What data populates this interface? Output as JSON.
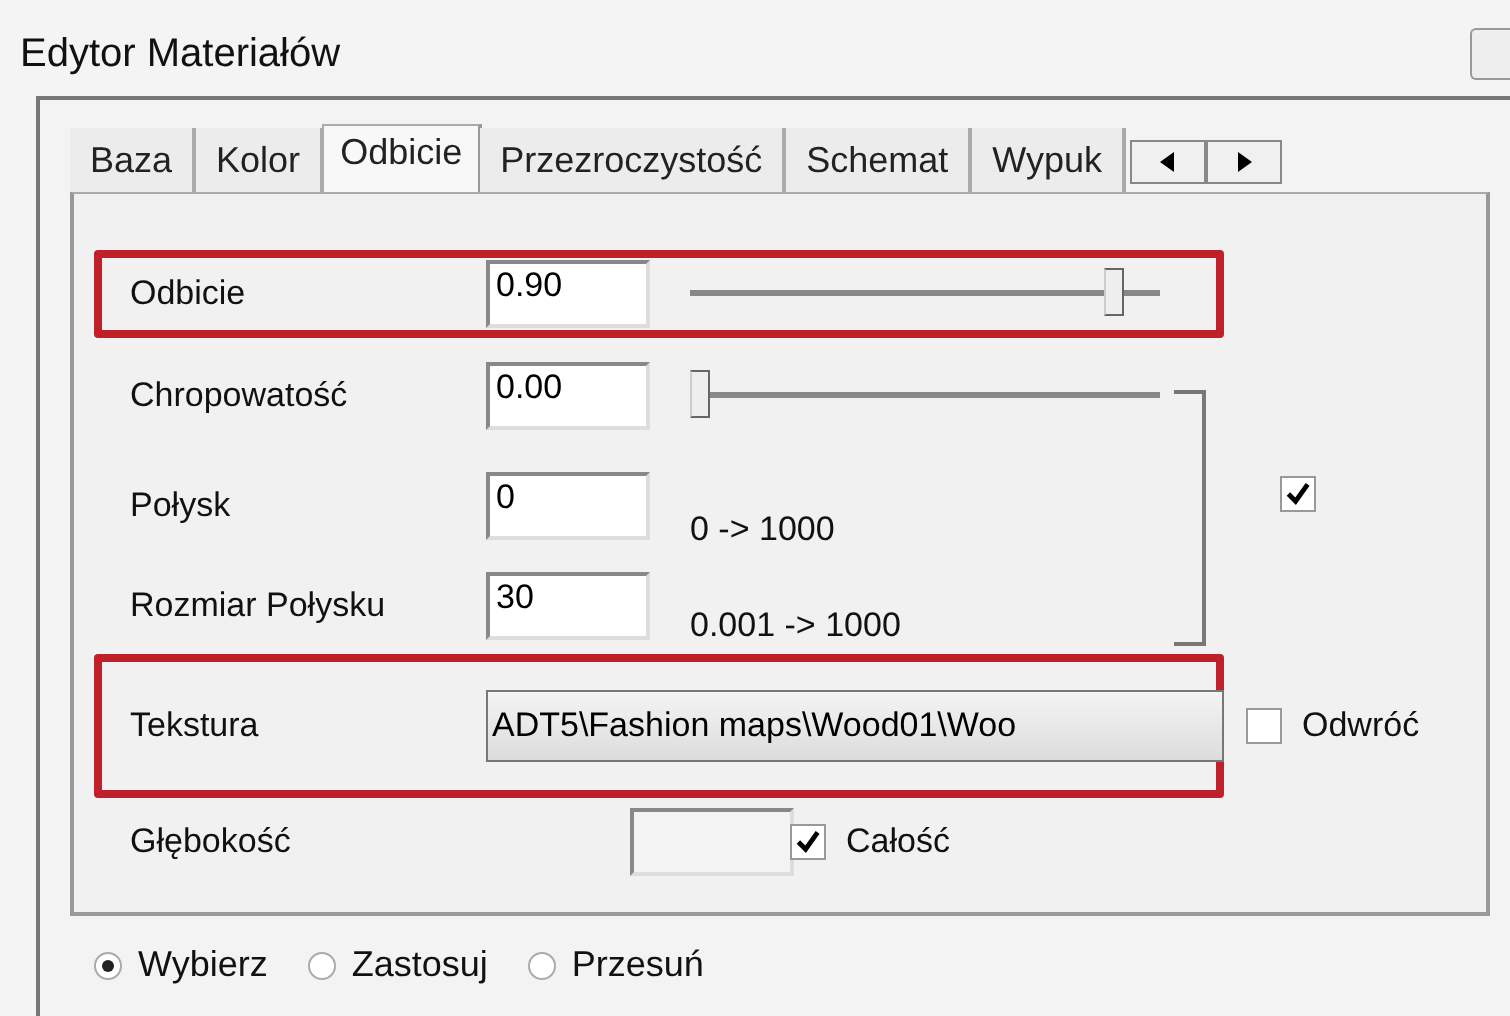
{
  "window": {
    "title": "Edytor Materiałów"
  },
  "tabs": [
    {
      "label": "Baza",
      "selected": false
    },
    {
      "label": "Kolor",
      "selected": false
    },
    {
      "label": "Odbicie",
      "selected": true
    },
    {
      "label": "Przezroczystość",
      "selected": false
    },
    {
      "label": "Schemat",
      "selected": false
    },
    {
      "label": "Wypuk",
      "selected": false
    }
  ],
  "rows": [
    {
      "kind": "slider",
      "label": "Odbicie",
      "value": "0.90",
      "level": 0.92,
      "highlighted": true
    },
    {
      "kind": "slider",
      "label": "Chropowatość",
      "value": "0.00",
      "level": 0,
      "highlighted": false
    },
    {
      "kind": "range",
      "label": "Połysk",
      "value": "0",
      "range": "0 -> 1000",
      "highlighted": false
    },
    {
      "kind": "range",
      "label": "Rozmiar Połysku",
      "value": "30",
      "range": "0.001 -> 1000",
      "highlighted": false
    },
    {
      "kind": "texture",
      "label": "Tekstura",
      "path": "ADT5\\Fashion maps\\Wood01\\Woo",
      "highlighted": true,
      "checkbox": {
        "label": "Odwróć",
        "checked": false
      }
    },
    {
      "kind": "depth",
      "label": "Głębokość",
      "highlighted": false,
      "checkbox": {
        "label": "Całość",
        "checked": true
      }
    }
  ],
  "group_checkbox": {
    "checked": true
  },
  "modes": [
    {
      "label": "Wybierz",
      "selected": true
    },
    {
      "label": "Zastosuj",
      "selected": false
    },
    {
      "label": "Przesuń",
      "selected": false
    }
  ]
}
